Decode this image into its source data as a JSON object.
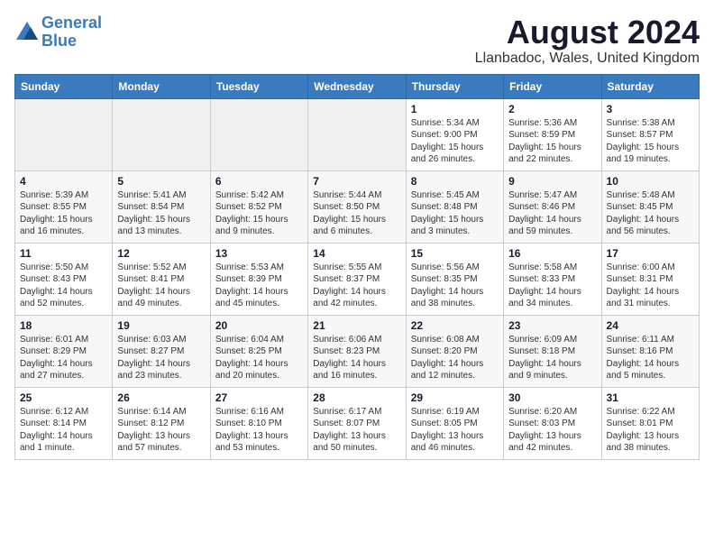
{
  "header": {
    "logo_line1": "General",
    "logo_line2": "Blue",
    "title": "August 2024",
    "subtitle": "Llanbadoc, Wales, United Kingdom"
  },
  "columns": [
    "Sunday",
    "Monday",
    "Tuesday",
    "Wednesday",
    "Thursday",
    "Friday",
    "Saturday"
  ],
  "weeks": [
    [
      {
        "day": "",
        "info": ""
      },
      {
        "day": "",
        "info": ""
      },
      {
        "day": "",
        "info": ""
      },
      {
        "day": "",
        "info": ""
      },
      {
        "day": "1",
        "info": "Sunrise: 5:34 AM\nSunset: 9:00 PM\nDaylight: 15 hours\nand 26 minutes."
      },
      {
        "day": "2",
        "info": "Sunrise: 5:36 AM\nSunset: 8:59 PM\nDaylight: 15 hours\nand 22 minutes."
      },
      {
        "day": "3",
        "info": "Sunrise: 5:38 AM\nSunset: 8:57 PM\nDaylight: 15 hours\nand 19 minutes."
      }
    ],
    [
      {
        "day": "4",
        "info": "Sunrise: 5:39 AM\nSunset: 8:55 PM\nDaylight: 15 hours\nand 16 minutes."
      },
      {
        "day": "5",
        "info": "Sunrise: 5:41 AM\nSunset: 8:54 PM\nDaylight: 15 hours\nand 13 minutes."
      },
      {
        "day": "6",
        "info": "Sunrise: 5:42 AM\nSunset: 8:52 PM\nDaylight: 15 hours\nand 9 minutes."
      },
      {
        "day": "7",
        "info": "Sunrise: 5:44 AM\nSunset: 8:50 PM\nDaylight: 15 hours\nand 6 minutes."
      },
      {
        "day": "8",
        "info": "Sunrise: 5:45 AM\nSunset: 8:48 PM\nDaylight: 15 hours\nand 3 minutes."
      },
      {
        "day": "9",
        "info": "Sunrise: 5:47 AM\nSunset: 8:46 PM\nDaylight: 14 hours\nand 59 minutes."
      },
      {
        "day": "10",
        "info": "Sunrise: 5:48 AM\nSunset: 8:45 PM\nDaylight: 14 hours\nand 56 minutes."
      }
    ],
    [
      {
        "day": "11",
        "info": "Sunrise: 5:50 AM\nSunset: 8:43 PM\nDaylight: 14 hours\nand 52 minutes."
      },
      {
        "day": "12",
        "info": "Sunrise: 5:52 AM\nSunset: 8:41 PM\nDaylight: 14 hours\nand 49 minutes."
      },
      {
        "day": "13",
        "info": "Sunrise: 5:53 AM\nSunset: 8:39 PM\nDaylight: 14 hours\nand 45 minutes."
      },
      {
        "day": "14",
        "info": "Sunrise: 5:55 AM\nSunset: 8:37 PM\nDaylight: 14 hours\nand 42 minutes."
      },
      {
        "day": "15",
        "info": "Sunrise: 5:56 AM\nSunset: 8:35 PM\nDaylight: 14 hours\nand 38 minutes."
      },
      {
        "day": "16",
        "info": "Sunrise: 5:58 AM\nSunset: 8:33 PM\nDaylight: 14 hours\nand 34 minutes."
      },
      {
        "day": "17",
        "info": "Sunrise: 6:00 AM\nSunset: 8:31 PM\nDaylight: 14 hours\nand 31 minutes."
      }
    ],
    [
      {
        "day": "18",
        "info": "Sunrise: 6:01 AM\nSunset: 8:29 PM\nDaylight: 14 hours\nand 27 minutes."
      },
      {
        "day": "19",
        "info": "Sunrise: 6:03 AM\nSunset: 8:27 PM\nDaylight: 14 hours\nand 23 minutes."
      },
      {
        "day": "20",
        "info": "Sunrise: 6:04 AM\nSunset: 8:25 PM\nDaylight: 14 hours\nand 20 minutes."
      },
      {
        "day": "21",
        "info": "Sunrise: 6:06 AM\nSunset: 8:23 PM\nDaylight: 14 hours\nand 16 minutes."
      },
      {
        "day": "22",
        "info": "Sunrise: 6:08 AM\nSunset: 8:20 PM\nDaylight: 14 hours\nand 12 minutes."
      },
      {
        "day": "23",
        "info": "Sunrise: 6:09 AM\nSunset: 8:18 PM\nDaylight: 14 hours\nand 9 minutes."
      },
      {
        "day": "24",
        "info": "Sunrise: 6:11 AM\nSunset: 8:16 PM\nDaylight: 14 hours\nand 5 minutes."
      }
    ],
    [
      {
        "day": "25",
        "info": "Sunrise: 6:12 AM\nSunset: 8:14 PM\nDaylight: 14 hours\nand 1 minute."
      },
      {
        "day": "26",
        "info": "Sunrise: 6:14 AM\nSunset: 8:12 PM\nDaylight: 13 hours\nand 57 minutes."
      },
      {
        "day": "27",
        "info": "Sunrise: 6:16 AM\nSunset: 8:10 PM\nDaylight: 13 hours\nand 53 minutes."
      },
      {
        "day": "28",
        "info": "Sunrise: 6:17 AM\nSunset: 8:07 PM\nDaylight: 13 hours\nand 50 minutes."
      },
      {
        "day": "29",
        "info": "Sunrise: 6:19 AM\nSunset: 8:05 PM\nDaylight: 13 hours\nand 46 minutes."
      },
      {
        "day": "30",
        "info": "Sunrise: 6:20 AM\nSunset: 8:03 PM\nDaylight: 13 hours\nand 42 minutes."
      },
      {
        "day": "31",
        "info": "Sunrise: 6:22 AM\nSunset: 8:01 PM\nDaylight: 13 hours\nand 38 minutes."
      }
    ]
  ]
}
